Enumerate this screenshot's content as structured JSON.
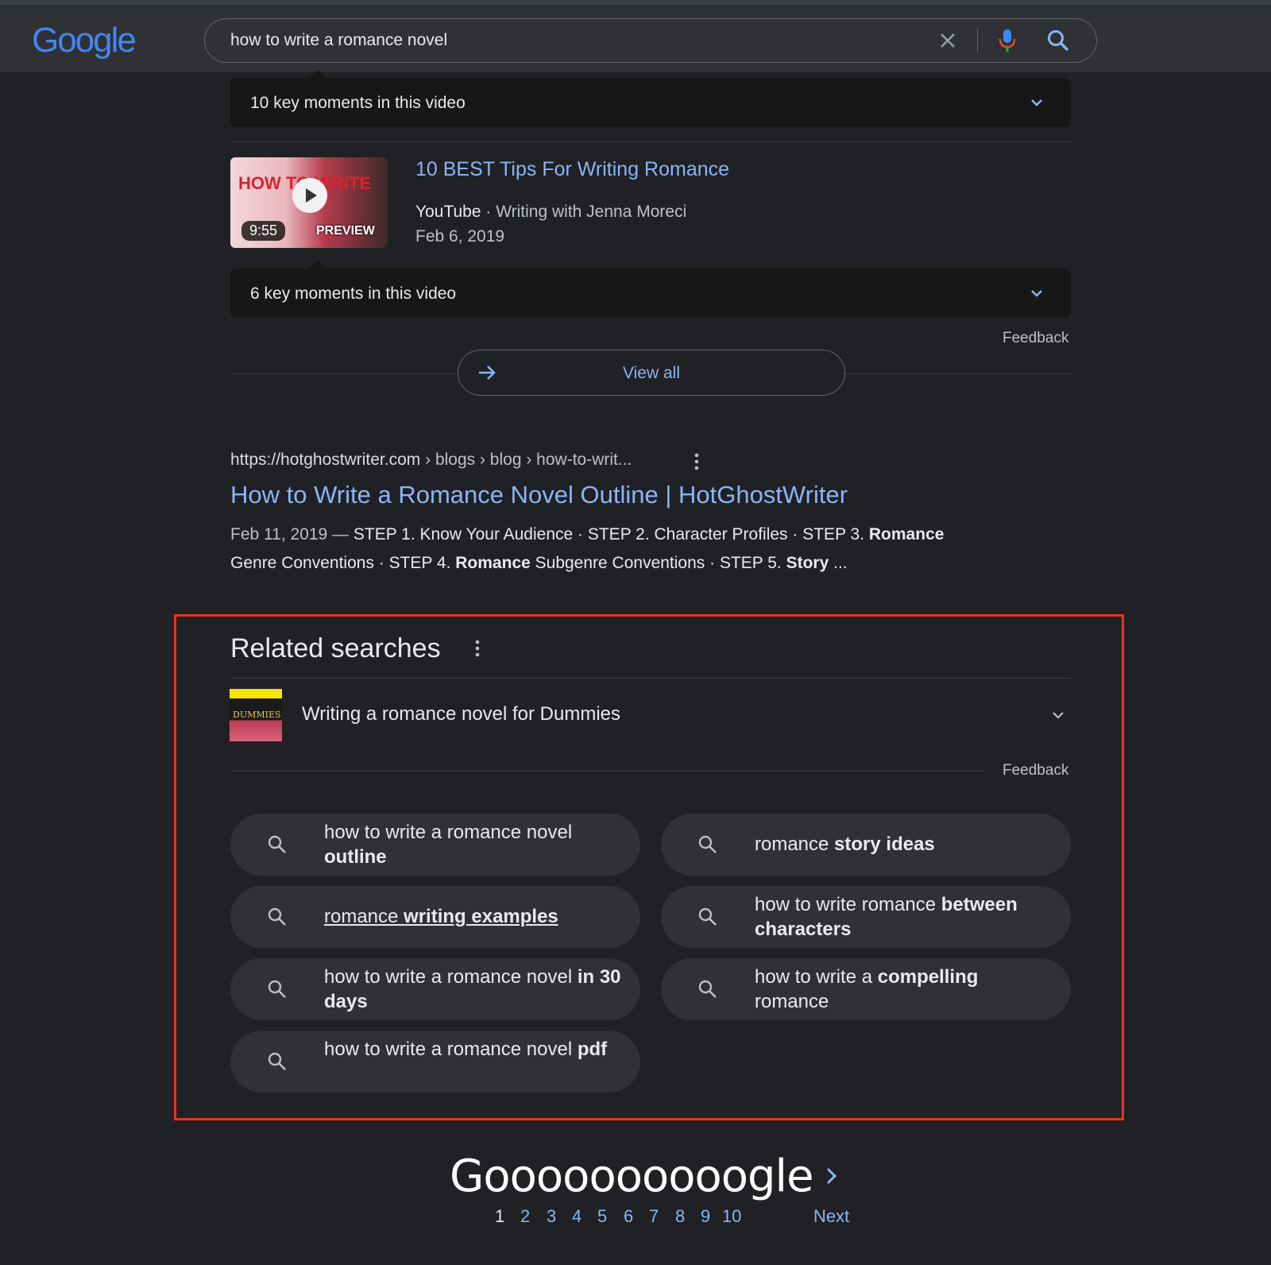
{
  "header": {
    "logo_text": "Google",
    "query": "how to write a romance novel"
  },
  "video_block": {
    "key_moments_1": "10 key moments in this video",
    "video_title": "10 BEST Tips For Writing Romance",
    "source": "YouTube",
    "channel": "Writing with Jenna Moreci",
    "date": "Feb 6, 2019",
    "duration": "9:55",
    "preview_label": "PREVIEW",
    "thumb_text": "HOW TO WRITE",
    "key_moments_2": "6 key moments in this video",
    "feedback": "Feedback",
    "view_all": "View all"
  },
  "result": {
    "site": "https://hotghostwriter.com",
    "path": " › blogs › blog › how-to-writ...",
    "title": "How to Write a Romance Novel Outline | HotGhostWriter",
    "date": "Feb 11, 2019 — ",
    "snip_1": "STEP 1. Know Your Audience · STEP 2. Character Profiles · STEP 3. ",
    "bold_1": "Romance",
    "snip_2": "Genre Conventions · STEP 4. ",
    "bold_2": "Romance",
    "snip_3": " Subgenre Conventions · STEP 5. ",
    "bold_3": "Story",
    "snip_4": " ..."
  },
  "related": {
    "title": "Related searches",
    "book_text": "DUMMIES",
    "entity": "Writing a romance novel for Dummies",
    "feedback": "Feedback",
    "chips": [
      {
        "plain": "how to write a romance novel ",
        "bold": "outline"
      },
      {
        "plain": "romance ",
        "bold": "story ideas"
      },
      {
        "plain": "romance ",
        "bold": "writing examples"
      },
      {
        "plain": "how to write romance ",
        "bold": "between characters"
      },
      {
        "plain": "how to write a romance novel ",
        "bold": "in 30 days"
      },
      {
        "plain": "how to write a ",
        "bold": "compelling",
        "tail": " romance"
      },
      {
        "plain": "how to write a romance novel ",
        "bold": "pdf"
      }
    ]
  },
  "pagination": {
    "footer_logo": "Goooooooooogle",
    "pages": [
      "1",
      "2",
      "3",
      "4",
      "5",
      "6",
      "7",
      "8",
      "9",
      "10"
    ],
    "current": "1",
    "next": "Next"
  },
  "colors": {
    "background": "#202124",
    "link": "#8ab4f8",
    "highlight_box": "#e8321f"
  }
}
